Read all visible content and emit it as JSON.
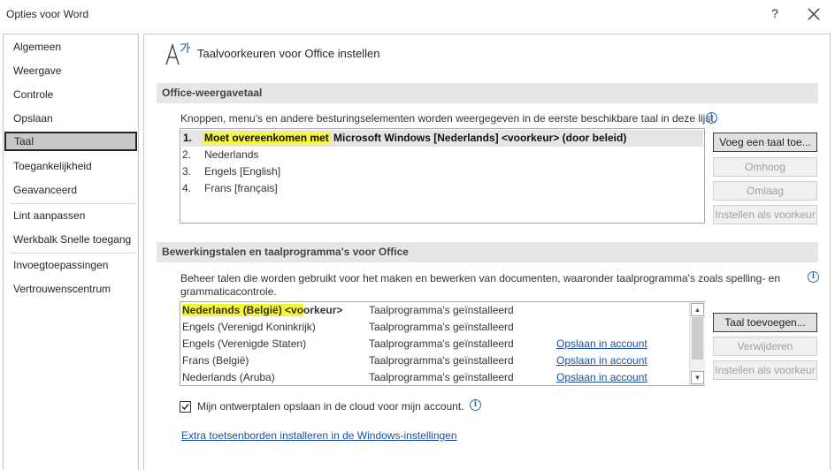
{
  "window": {
    "title": "Opties voor Word",
    "help_label": "?"
  },
  "sidebar": {
    "items": [
      {
        "label": "Algemeen"
      },
      {
        "label": "Weergave"
      },
      {
        "label": "Controle"
      },
      {
        "label": "Opslaan"
      },
      {
        "label": "Taal",
        "selected": true
      },
      {
        "label": "Toegankelijkheid"
      },
      {
        "label": "Geavanceerd"
      },
      {
        "label": "Lint aanpassen"
      },
      {
        "label": "Werkbalk Snelle toegang"
      },
      {
        "label": "Invoegtoepassingen"
      },
      {
        "label": "Vertrouwenscentrum"
      }
    ]
  },
  "header": {
    "title": "Taalvoorkeuren voor Office instellen",
    "icon": "language-icon"
  },
  "display_language": {
    "section_title": "Office-weergavetaal",
    "description": "Knoppen, menu's en andere besturingselementen worden weergegeven in de eerste beschikbare taal in deze lijst.",
    "items": [
      {
        "num": "1.",
        "label_highlight": "Moet overeenkomen met",
        "label_rest": " Microsoft Windows [Nederlands] <voorkeur> (door beleid)"
      },
      {
        "num": "2.",
        "label": "Nederlands"
      },
      {
        "num": "3.",
        "label": "Engels [English]"
      },
      {
        "num": "4.",
        "label": "Frans [français]"
      }
    ],
    "buttons": {
      "add": "Voeg een taal toe...",
      "up": "Omhoog",
      "down": "Omlaag",
      "set_pref": "Instellen als voorkeur"
    }
  },
  "editing_languages": {
    "section_title": "Bewerkingstalen en taalprogramma's voor Office",
    "description_line1": "Beheer talen die worden gebruikt voor het maken en bewerken van documenten, waaronder taalprogramma's zoals spelling- en",
    "description_line2": "grammaticacontrole.",
    "rows": [
      {
        "language_hl": "Nederlands (België) <vo",
        "language_rest": "orkeur>",
        "status": "Taalprogramma's geïnstalleerd",
        "action": ""
      },
      {
        "language": "Engels (Verenigd Koninkrijk)",
        "status": "Taalprogramma's geïnstalleerd",
        "action": ""
      },
      {
        "language": "Engels (Verenigde Staten)",
        "status": "Taalprogramma's geïnstalleerd",
        "action": "Opslaan in account"
      },
      {
        "language": "Frans (België)",
        "status": "Taalprogramma's geïnstalleerd",
        "action": "Opslaan in account"
      },
      {
        "language": "Nederlands (Aruba)",
        "status": "Taalprogramma's geïnstalleerd",
        "action": "Opslaan in account"
      }
    ],
    "buttons": {
      "add": "Taal toevoegen...",
      "remove": "Verwijderen",
      "set_pref": "Instellen als voorkeur"
    },
    "cloud_checkbox_label": "Mijn ontwerptalen opslaan in de cloud voor mijn account.",
    "cloud_checked": true,
    "keyboards_link": "Extra toetsenborden installeren in de Windows-instellingen"
  },
  "colors": {
    "highlight": "#f5f53a",
    "link": "#1a4fa3",
    "selected_nav": "#c8c8c8"
  }
}
